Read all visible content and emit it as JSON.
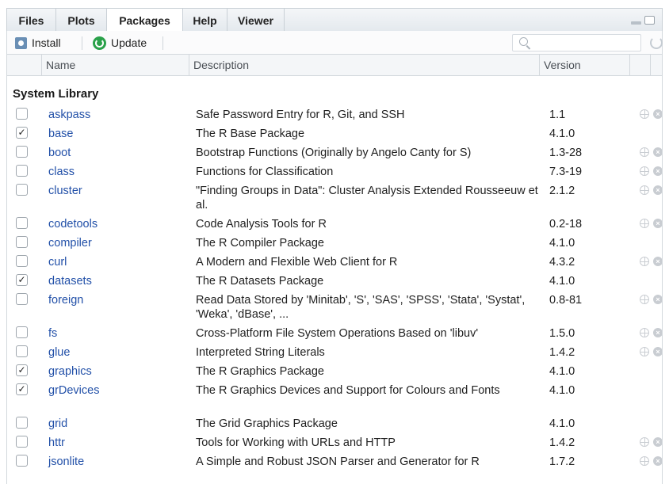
{
  "tabs": [
    {
      "label": "Files",
      "active": false
    },
    {
      "label": "Plots",
      "active": false
    },
    {
      "label": "Packages",
      "active": true
    },
    {
      "label": "Help",
      "active": false
    },
    {
      "label": "Viewer",
      "active": false
    }
  ],
  "toolbar": {
    "install_label": "Install",
    "update_label": "Update",
    "search_value": "",
    "search_placeholder": ""
  },
  "columns": {
    "name": "Name",
    "description": "Description",
    "version": "Version"
  },
  "group": {
    "label": "System Library"
  },
  "packages": [
    {
      "checked": false,
      "name": "askpass",
      "description": "Safe Password Entry for R, Git, and SSH",
      "version": "1.1",
      "tall": false,
      "icons": true
    },
    {
      "checked": true,
      "name": "base",
      "description": "The R Base Package",
      "version": "4.1.0",
      "tall": false,
      "icons": false
    },
    {
      "checked": false,
      "name": "boot",
      "description": "Bootstrap Functions (Originally by Angelo Canty for S)",
      "version": "1.3-28",
      "tall": false,
      "icons": true
    },
    {
      "checked": false,
      "name": "class",
      "description": "Functions for Classification",
      "version": "7.3-19",
      "tall": false,
      "icons": true
    },
    {
      "checked": false,
      "name": "cluster",
      "description": "\"Finding Groups in Data\": Cluster Analysis Extended Rousseeuw et al.",
      "version": "2.1.2",
      "tall": true,
      "icons": true
    },
    {
      "checked": false,
      "name": "codetools",
      "description": "Code Analysis Tools for R",
      "version": "0.2-18",
      "tall": false,
      "icons": true
    },
    {
      "checked": false,
      "name": "compiler",
      "description": "The R Compiler Package",
      "version": "4.1.0",
      "tall": false,
      "icons": false
    },
    {
      "checked": false,
      "name": "curl",
      "description": "A Modern and Flexible Web Client for R",
      "version": "4.3.2",
      "tall": false,
      "icons": true
    },
    {
      "checked": true,
      "name": "datasets",
      "description": "The R Datasets Package",
      "version": "4.1.0",
      "tall": false,
      "icons": false
    },
    {
      "checked": false,
      "name": "foreign",
      "description": "Read Data Stored by 'Minitab', 'S', 'SAS', 'SPSS', 'Stata', 'Systat', 'Weka', 'dBase', ...",
      "version": "0.8-81",
      "tall": true,
      "icons": true
    },
    {
      "checked": false,
      "name": "fs",
      "description": "Cross-Platform File System Operations Based on 'libuv'",
      "version": "1.5.0",
      "tall": false,
      "icons": true
    },
    {
      "checked": false,
      "name": "glue",
      "description": "Interpreted String Literals",
      "version": "1.4.2",
      "tall": false,
      "icons": true
    },
    {
      "checked": true,
      "name": "graphics",
      "description": "The R Graphics Package",
      "version": "4.1.0",
      "tall": false,
      "icons": false
    },
    {
      "checked": true,
      "name": "grDevices",
      "description": "The R Graphics Devices and Support for Colours and Fonts",
      "version": "4.1.0",
      "tall": true,
      "icons": false
    },
    {
      "checked": false,
      "name": "grid",
      "description": "The Grid Graphics Package",
      "version": "4.1.0",
      "tall": false,
      "icons": false
    },
    {
      "checked": false,
      "name": "httr",
      "description": "Tools for Working with URLs and HTTP",
      "version": "1.4.2",
      "tall": false,
      "icons": true
    },
    {
      "checked": false,
      "name": "jsonlite",
      "description": "A Simple and Robust JSON Parser and Generator for R",
      "version": "1.7.2",
      "tall": false,
      "icons": true
    }
  ],
  "colors": {
    "link": "#2250a8",
    "update_green": "#2aa14a",
    "install_blue": "#6a8fb5"
  }
}
